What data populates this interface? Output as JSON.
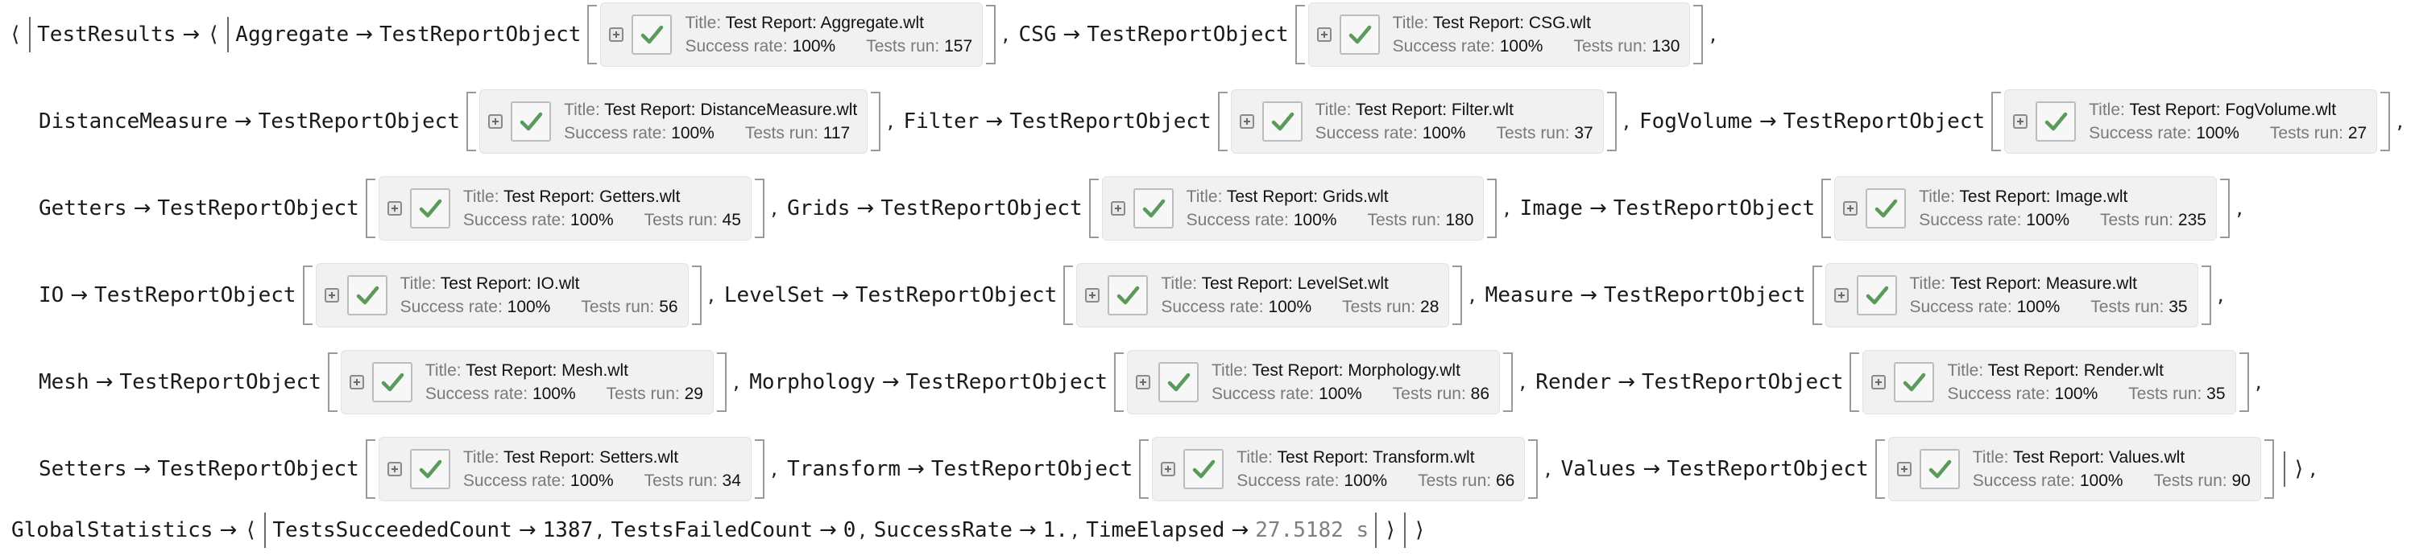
{
  "symbols": {
    "arrow": "→",
    "open_assoc": "⟨",
    "close_assoc": "⟩",
    "comma": ","
  },
  "labels": {
    "title_label": "Title:",
    "success_label": "Success rate:",
    "tests_label": "Tests run:"
  },
  "root_key": "TestResults",
  "head": "TestReportObject",
  "reports": [
    {
      "name": "Aggregate",
      "title": "Test Report: Aggregate.wlt",
      "success": "100%",
      "tests": "157"
    },
    {
      "name": "CSG",
      "title": "Test Report: CSG.wlt",
      "success": "100%",
      "tests": "130"
    },
    {
      "name": "DistanceMeasure",
      "title": "Test Report: DistanceMeasure.wlt",
      "success": "100%",
      "tests": "117"
    },
    {
      "name": "Filter",
      "title": "Test Report: Filter.wlt",
      "success": "100%",
      "tests": "37"
    },
    {
      "name": "FogVolume",
      "title": "Test Report: FogVolume.wlt",
      "success": "100%",
      "tests": "27"
    },
    {
      "name": "Getters",
      "title": "Test Report: Getters.wlt",
      "success": "100%",
      "tests": "45"
    },
    {
      "name": "Grids",
      "title": "Test Report: Grids.wlt",
      "success": "100%",
      "tests": "180"
    },
    {
      "name": "Image",
      "title": "Test Report: Image.wlt",
      "success": "100%",
      "tests": "235"
    },
    {
      "name": "IO",
      "title": "Test Report: IO.wlt",
      "success": "100%",
      "tests": "56"
    },
    {
      "name": "LevelSet",
      "title": "Test Report: LevelSet.wlt",
      "success": "100%",
      "tests": "28"
    },
    {
      "name": "Measure",
      "title": "Test Report: Measure.wlt",
      "success": "100%",
      "tests": "35"
    },
    {
      "name": "Mesh",
      "title": "Test Report: Mesh.wlt",
      "success": "100%",
      "tests": "29"
    },
    {
      "name": "Morphology",
      "title": "Test Report: Morphology.wlt",
      "success": "100%",
      "tests": "86"
    },
    {
      "name": "Render",
      "title": "Test Report: Render.wlt",
      "success": "100%",
      "tests": "35"
    },
    {
      "name": "Setters",
      "title": "Test Report: Setters.wlt",
      "success": "100%",
      "tests": "34"
    },
    {
      "name": "Transform",
      "title": "Test Report: Transform.wlt",
      "success": "100%",
      "tests": "66"
    },
    {
      "name": "Values",
      "title": "Test Report: Values.wlt",
      "success": "100%",
      "tests": "90"
    }
  ],
  "global": {
    "key": "GlobalStatistics",
    "items": [
      {
        "key": "TestsSucceededCount",
        "value": "1387"
      },
      {
        "key": "TestsFailedCount",
        "value": "0"
      },
      {
        "key": "SuccessRate",
        "value": "1."
      },
      {
        "key": "TimeElapsed",
        "value": "27.5182 s"
      }
    ]
  },
  "colors": {
    "check_green": "#5a9a5a",
    "card_bg": "#f1f1f1",
    "label_gray": "#7a7a7a"
  }
}
